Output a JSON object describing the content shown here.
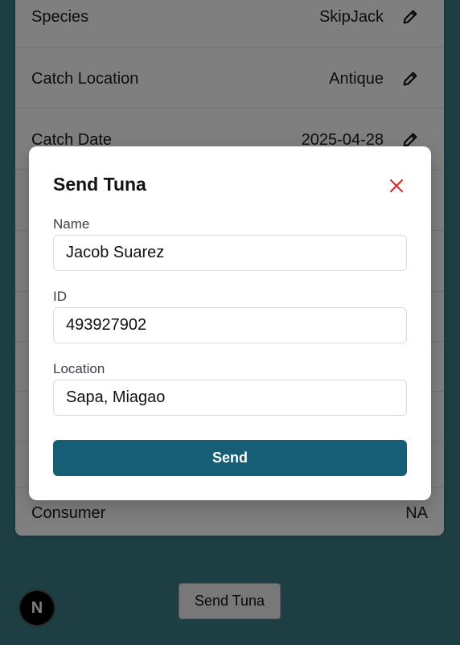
{
  "details": {
    "rows": [
      {
        "label": "Species",
        "value": "SkipJack",
        "editable": true
      },
      {
        "label": "Catch Location",
        "value": "Antique",
        "editable": true
      },
      {
        "label": "Catch Date",
        "value": "2025-04-28",
        "editable": true
      },
      {
        "label": "Consumer",
        "value": "NA",
        "editable": false
      }
    ]
  },
  "actions": {
    "send_tuna_label": "Send Tuna"
  },
  "badge": {
    "letter": "N"
  },
  "modal": {
    "title": "Send Tuna",
    "fields": {
      "name": {
        "label": "Name",
        "value": "Jacob Suarez"
      },
      "id": {
        "label": "ID",
        "value": "493927902"
      },
      "location": {
        "label": "Location",
        "value": "Sapa, Miagao"
      }
    },
    "submit_label": "Send"
  },
  "colors": {
    "background": "#3a7f86",
    "primary_button": "#155e75",
    "close_icon": "#dc2626"
  },
  "icons": [
    "pencil-icon",
    "close-icon",
    "next-logo-icon"
  ]
}
